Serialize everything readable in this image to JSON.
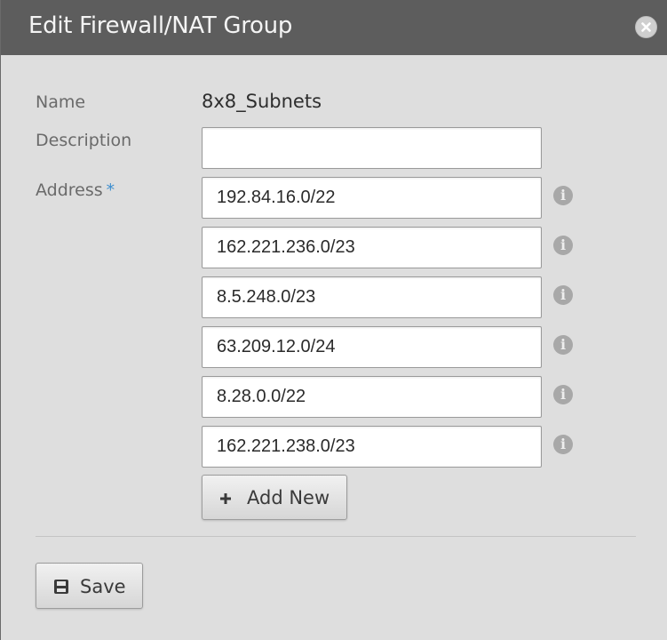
{
  "dialog": {
    "title": "Edit Firewall/NAT Group"
  },
  "form": {
    "name_label": "Name",
    "name_value": "8x8_Subnets",
    "description_label": "Description",
    "description_value": "",
    "address_label": "Address",
    "required_marker": "*",
    "addresses": [
      "192.84.16.0/22",
      "162.221.236.0/23",
      "8.5.248.0/23",
      "63.209.12.0/24",
      "8.28.0.0/22",
      "162.221.238.0/23"
    ],
    "info_glyph": "i"
  },
  "buttons": {
    "add_new_label": "Add New",
    "save_label": "Save"
  },
  "icons": {
    "close": "close-icon",
    "info": "info-icon",
    "add": "plus-icon",
    "save": "floppy-disk-icon"
  },
  "colors": {
    "titlebar": "#5d5d5d",
    "required_star": "#3c8ecf",
    "info_icon": "#a8a8a8"
  }
}
